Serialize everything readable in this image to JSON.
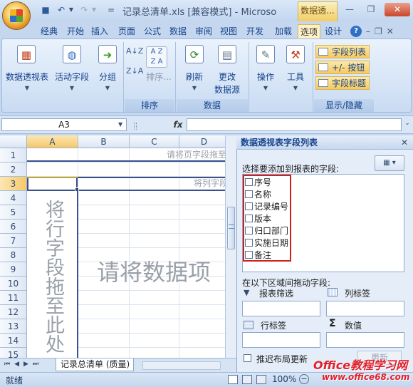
{
  "titlebar": {
    "title": "记录总清单.xls [兼容模式] - Microso",
    "context_tab": "数据透...",
    "qat_more": "="
  },
  "tabs": [
    "经典",
    "开始",
    "插入",
    "页面",
    "公式",
    "数据",
    "审阅",
    "视图",
    "开发",
    "加载",
    "选项",
    "设计"
  ],
  "active_tab": "选项",
  "ribbon": {
    "pivot_table_label": "数据透视表",
    "active_field_label": "活动字段",
    "group_label": "分组",
    "sort_label": "排序...",
    "sort_group": "排序",
    "refresh_label": "刷新",
    "change_source_label1": "更改",
    "change_source_label2": "数据源",
    "data_group": "数据",
    "actions_label": "操作",
    "tools_label": "工具",
    "field_list_btn": "字段列表",
    "plusminus_btn": "+/- 按钮",
    "field_headers_btn": "字段标题",
    "show_hide_group": "显示/隐藏"
  },
  "formula_bar": {
    "namebox": "A3",
    "fx": "fx"
  },
  "sheet": {
    "columns": [
      "A",
      "B",
      "C",
      "D"
    ],
    "rows": [
      "1",
      "2",
      "3",
      "4",
      "5",
      "6",
      "7",
      "8",
      "9",
      "10",
      "11",
      "12",
      "13",
      "14",
      "15"
    ],
    "page_field_hint": "请将页字段拖至",
    "column_field_hint": "将列字段",
    "row_field_hint": "将行字段拖至此处",
    "data_field_hint": "请将数据项"
  },
  "sheet_tabs": {
    "tab_label": "记录总清单 (质量)"
  },
  "status": {
    "ready": "就绪",
    "zoom": "100%"
  },
  "panel": {
    "title": "数据透视表字段列表",
    "choose_prompt": "选择要添加到报表的字段:",
    "fields": [
      "序号",
      "名称",
      "记录编号",
      "版本",
      "归口部门",
      "实施日期",
      "备注"
    ],
    "drag_prompt": "在以下区域间拖动字段:",
    "report_filter": "报表筛选",
    "column_labels": "列标签",
    "row_labels": "行标签",
    "values": "数值",
    "defer_update": "推迟布局更新",
    "update_button": "更新"
  },
  "watermark": {
    "brand": "Office教程学习网",
    "url": "www.office68.com"
  }
}
